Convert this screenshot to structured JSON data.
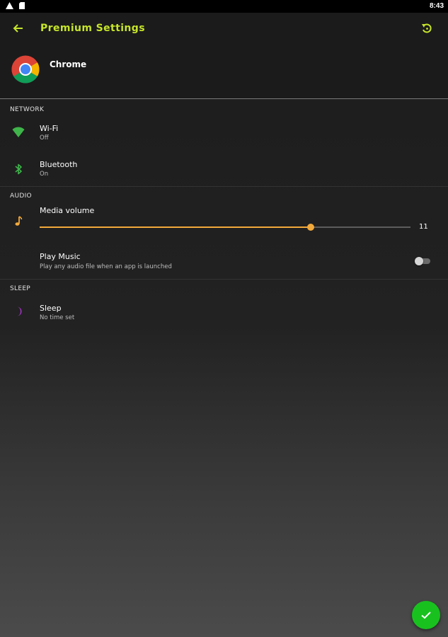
{
  "status_bar": {
    "time": "8:43",
    "icons": [
      "warning-icon",
      "sd-card-icon"
    ]
  },
  "toolbar": {
    "title": "Premium Settings",
    "back_icon": "arrow-back-icon",
    "reset_icon": "restore-icon"
  },
  "app": {
    "name": "Chrome",
    "icon": "chrome-icon"
  },
  "sections": {
    "network": {
      "label": "NETWORK",
      "wifi": {
        "title": "Wi-Fi",
        "subtitle": "Off",
        "icon": "wifi-icon"
      },
      "bluetooth": {
        "title": "Bluetooth",
        "subtitle": "On",
        "icon": "bluetooth-icon"
      }
    },
    "audio": {
      "label": "AUDIO",
      "media_volume": {
        "title": "Media volume",
        "value": "11",
        "fraction": 0.73,
        "icon": "music-note-icon"
      },
      "play_music": {
        "title": "Play Music",
        "subtitle": "Play any audio file when an app is launched",
        "enabled": false
      }
    },
    "sleep": {
      "label": "SLEEP",
      "sleep": {
        "title": "Sleep",
        "subtitle": "No time set",
        "icon": "moon-icon"
      }
    }
  },
  "fab": {
    "icon": "check-icon"
  },
  "colors": {
    "accent_title": "#c6e52a",
    "wifi": "#3fb44a",
    "bluetooth": "#3fb44a",
    "slider": "#f2a93b",
    "sleep": "#a636c9",
    "fab": "#19c11f"
  }
}
